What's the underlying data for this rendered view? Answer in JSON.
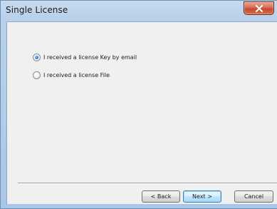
{
  "window": {
    "title": "Single License"
  },
  "options": [
    {
      "label": "I received a license Key by email",
      "checked": true
    },
    {
      "label": "I received a license File",
      "checked": false
    }
  ],
  "buttons": {
    "back": "< Back",
    "next": "Next >",
    "cancel": "Cancel"
  },
  "colors": {
    "titlebar": "#b9d1ea",
    "close_button": "#c74a2f",
    "client_background": "#f0f0f0",
    "default_button_border": "#3c7fb1"
  },
  "icons": {
    "close": "close-icon"
  }
}
